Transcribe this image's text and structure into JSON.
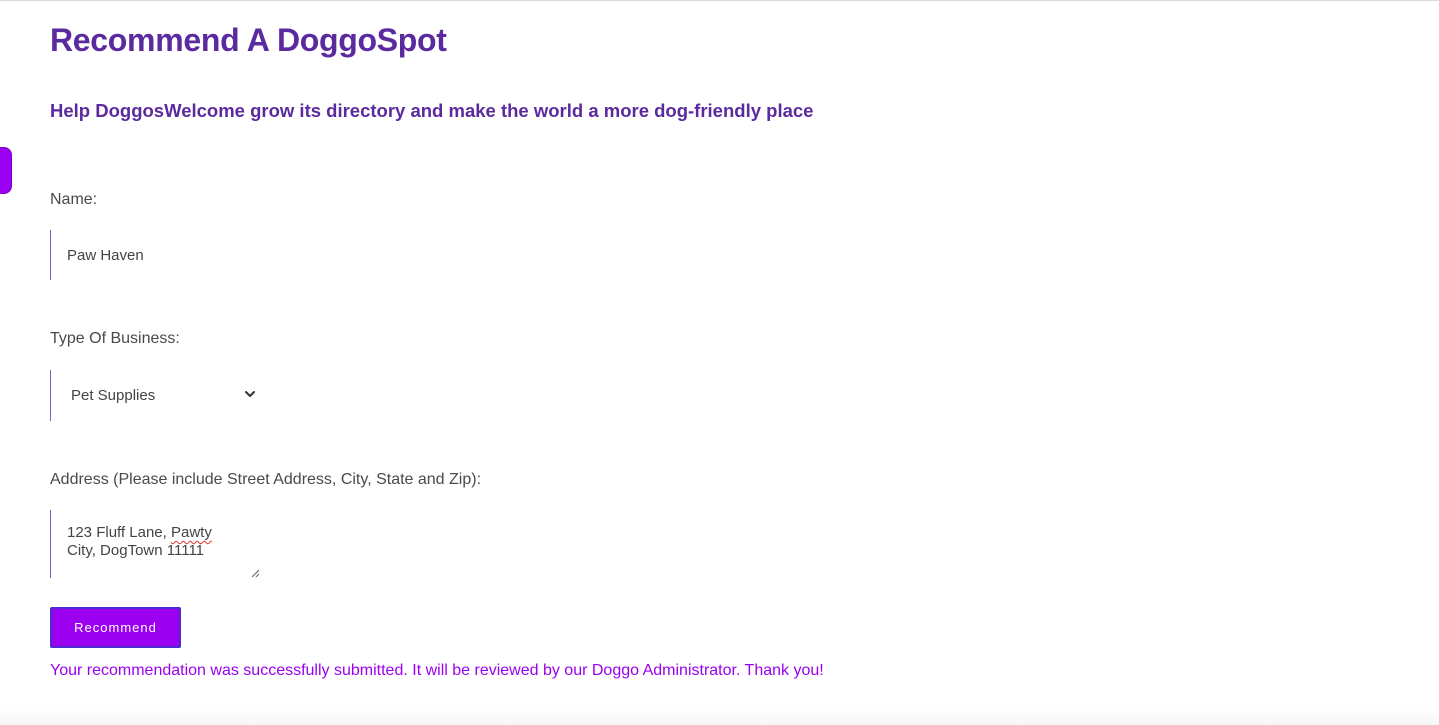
{
  "page": {
    "title": "Recommend A DoggoSpot",
    "subtitle": "Help DoggosWelcome grow its directory and make the world a more dog-friendly place"
  },
  "form": {
    "name_label": "Name:",
    "name_value": "Paw Haven",
    "type_label": "Type Of Business:",
    "type_selected": "Pet Supplies",
    "address_label": "Address (Please include Street Address, City, State and Zip):",
    "address_value": "123 Fluff Lane, Pawty City, DogTown 11111",
    "address_line1_prefix": "123 Fluff Lane, ",
    "address_line1_misspelled": "Pawty",
    "address_line2": "City, DogTown 11111",
    "submit_label": "Recommend"
  },
  "status": {
    "success_message": "Your recommendation was successfully submitted. It will be reviewed by our Doggo Administrator. Thank you!"
  },
  "colors": {
    "heading": "#5b2a9f",
    "accent": "#9b00f0",
    "button_border": "#4a2bd0",
    "field_border": "#7a5bc7"
  },
  "icons": {
    "select": "chevron-down-icon",
    "textarea": "resize-grip-icon"
  }
}
